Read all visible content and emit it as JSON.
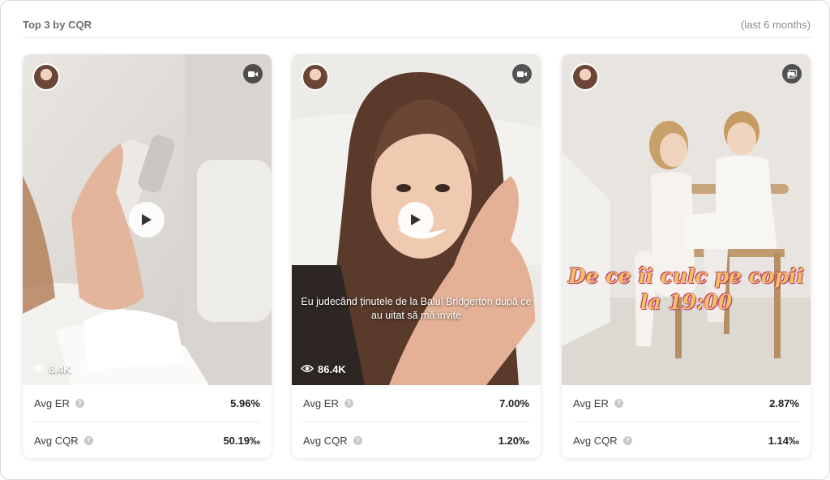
{
  "header": {
    "title": "Top 3 by CQR",
    "period": "(last 6 months)"
  },
  "cards": [
    {
      "media_type": "video-icon",
      "views": "6.4K",
      "caption": "",
      "overlay_text": "",
      "metrics": {
        "avg_er_label": "Avg ER",
        "avg_er": "5.96%",
        "avg_cqr_label": "Avg CQR",
        "avg_cqr": "50.19‰"
      }
    },
    {
      "media_type": "video-icon",
      "views": "86.4K",
      "caption": "Eu judecând ținutele de la Balul Bridgerton după ce au uitat să mă invite",
      "overlay_text": "",
      "metrics": {
        "avg_er_label": "Avg ER",
        "avg_er": "7.00%",
        "avg_cqr_label": "Avg CQR",
        "avg_cqr": "1.20‰"
      }
    },
    {
      "media_type": "image-gallery-icon",
      "views": "",
      "caption": "",
      "overlay_text": "De ce îi culc pe copii\nla 19:00",
      "metrics": {
        "avg_er_label": "Avg ER",
        "avg_er": "2.87%",
        "avg_cqr_label": "Avg CQR",
        "avg_cqr": "1.14‰"
      }
    }
  ]
}
